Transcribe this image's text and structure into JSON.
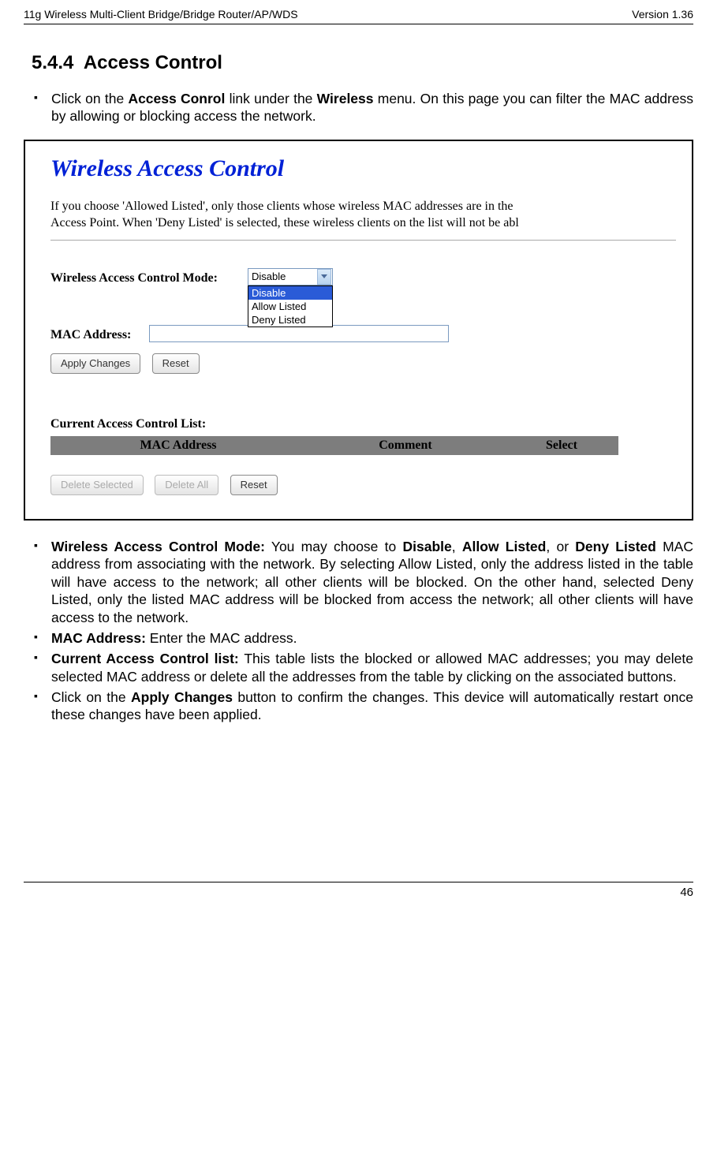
{
  "header": {
    "left": "11g Wireless Multi-Client Bridge/Bridge Router/AP/WDS",
    "right": "Version 1.36"
  },
  "heading_num": "5.4.4",
  "heading_title": "Access Control",
  "intro_pre": "Click on the ",
  "intro_b1": "Access Conrol",
  "intro_mid": " link under the ",
  "intro_b2": "Wireless",
  "intro_post": " menu. On this page you can filter the MAC address by allowing or blocking access the network.",
  "shot": {
    "title": "Wireless Access Control",
    "desc_l1": "If you choose 'Allowed Listed', only those clients whose wireless MAC addresses are in the",
    "desc_l2": "Access Point. When 'Deny Listed' is selected, these wireless clients on the list will not be abl",
    "label_mode": "Wireless Access Control Mode:",
    "label_mac": "MAC Address:",
    "select": {
      "value": "Disable",
      "options": [
        "Disable",
        "Allow Listed",
        "Deny Listed"
      ]
    },
    "btn_apply": "Apply Changes",
    "btn_reset": "Reset",
    "table_title": "Current Access Control List:",
    "col_mac": "MAC Address",
    "col_comment": "Comment",
    "col_select": "Select",
    "btn_delsel": "Delete Selected",
    "btn_delall": "Delete All",
    "btn_reset2": "Reset"
  },
  "bullets": {
    "b1": {
      "lead": "Wireless Access Control Mode:",
      "t1": " You may choose to ",
      "opt1": "Disable",
      "t2": ", ",
      "opt2": "Allow Listed",
      "t3": ", or ",
      "opt3": "Deny Listed",
      "rest": " MAC address from associating with the network. By selecting Allow Listed, only the address listed in the table will have access to the network; all other clients will be blocked. On the other hand, selected Deny Listed, only the listed MAC address will be blocked from access the network; all other clients will have access to the network."
    },
    "b2": {
      "lead": "MAC Address:",
      "rest": " Enter the MAC address."
    },
    "b3": {
      "lead": "Current Access Control list:",
      "rest": " This table lists the blocked or allowed MAC addresses; you may delete selected MAC address or delete all the addresses from the table by clicking on the associated buttons."
    },
    "b4": {
      "t1": "Click on the ",
      "lead": "Apply Changes",
      "rest": " button to confirm the changes. This device will automatically restart once these changes have been applied."
    }
  },
  "page_number": "46"
}
